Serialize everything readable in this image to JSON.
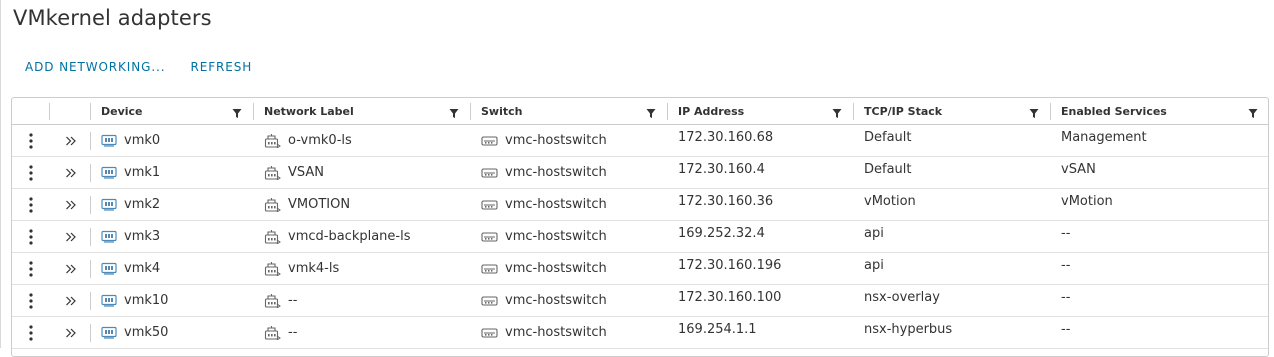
{
  "page": {
    "title": "VMkernel adapters"
  },
  "toolbar": {
    "add_networking": "ADD NETWORKING...",
    "refresh": "REFRESH"
  },
  "table": {
    "columns": [
      "Device",
      "Network Label",
      "Switch",
      "IP Address",
      "TCP/IP Stack",
      "Enabled Services"
    ],
    "rows": [
      {
        "device": "vmk0",
        "label": "o-vmk0-ls",
        "switch": "vmc-hostswitch",
        "ip": "172.30.160.68",
        "stack": "Default",
        "services": "Management"
      },
      {
        "device": "vmk1",
        "label": "VSAN",
        "switch": "vmc-hostswitch",
        "ip": "172.30.160.4",
        "stack": "Default",
        "services": "vSAN"
      },
      {
        "device": "vmk2",
        "label": "VMOTION",
        "switch": "vmc-hostswitch",
        "ip": "172.30.160.36",
        "stack": "vMotion",
        "services": "vMotion"
      },
      {
        "device": "vmk3",
        "label": "vmcd-backplane-ls",
        "switch": "vmc-hostswitch",
        "ip": "169.252.32.4",
        "stack": "api",
        "services": "--"
      },
      {
        "device": "vmk4",
        "label": "vmk4-ls",
        "switch": "vmc-hostswitch",
        "ip": "172.30.160.196",
        "stack": "api",
        "services": "--"
      },
      {
        "device": "vmk10",
        "label": "--",
        "switch": "vmc-hostswitch",
        "ip": "172.30.160.100",
        "stack": "nsx-overlay",
        "services": "--"
      },
      {
        "device": "vmk50",
        "label": "--",
        "switch": "vmc-hostswitch",
        "ip": "169.254.1.1",
        "stack": "nsx-hyperbus",
        "services": "--"
      }
    ]
  },
  "icons": {
    "row_menu": "vertical-ellipsis-icon",
    "row_expand": "double-chevron-right-icon",
    "device": "network-adapter-icon",
    "network_label": "network-portgroup-icon",
    "switch": "virtual-switch-icon",
    "filter": "filter-icon"
  },
  "colors": {
    "accent": "#0072a3",
    "text": "#333333",
    "border": "#cccccc"
  }
}
